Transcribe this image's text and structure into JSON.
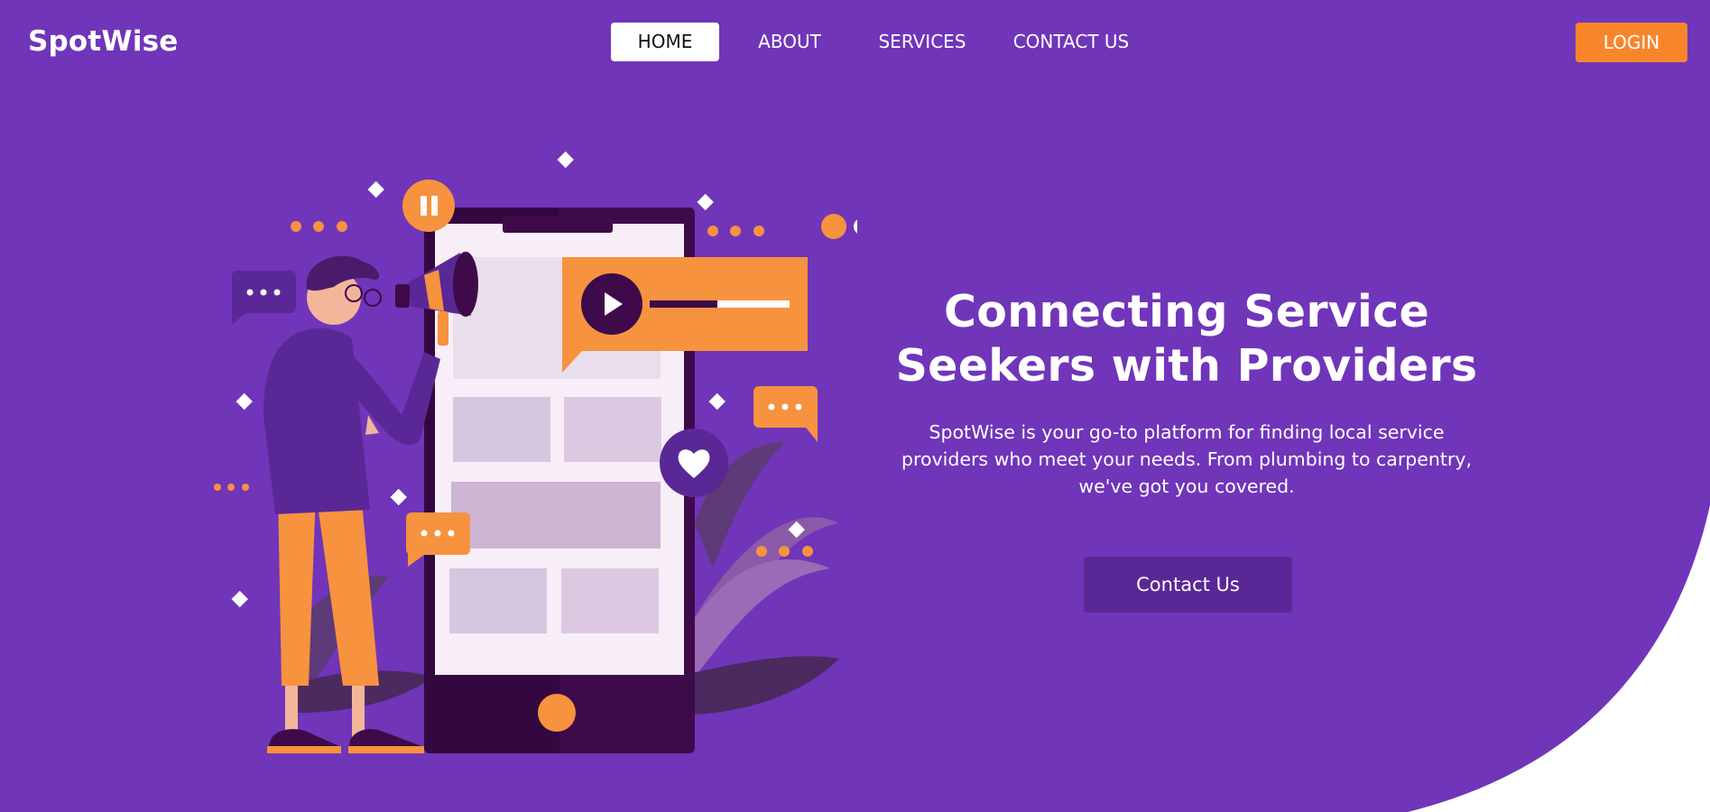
{
  "brand": {
    "name": "SpotWise"
  },
  "nav": {
    "items": [
      {
        "label": "HOME",
        "active": true
      },
      {
        "label": "ABOUT",
        "active": false
      },
      {
        "label": "SERVICES",
        "active": false
      },
      {
        "label": "CONTACT US",
        "active": false
      }
    ],
    "login_label": "LOGIN"
  },
  "hero": {
    "title_line1": "Connecting Service",
    "title_line2": "Seekers with Providers",
    "description": "SpotWise is your go-to platform for finding local service providers who meet your needs. From plumbing to carpentry, we've got you covered.",
    "cta_label": "Contact Us"
  },
  "colors": {
    "background": "#7035b9",
    "accent": "#f9852b",
    "dark_purple": "#3f0a4a",
    "button_purple": "#5a2896"
  },
  "illustration": {
    "icons": [
      "megaphone-icon",
      "play-icon",
      "pause-icon",
      "heart-icon",
      "chat-bubble-icon"
    ]
  }
}
